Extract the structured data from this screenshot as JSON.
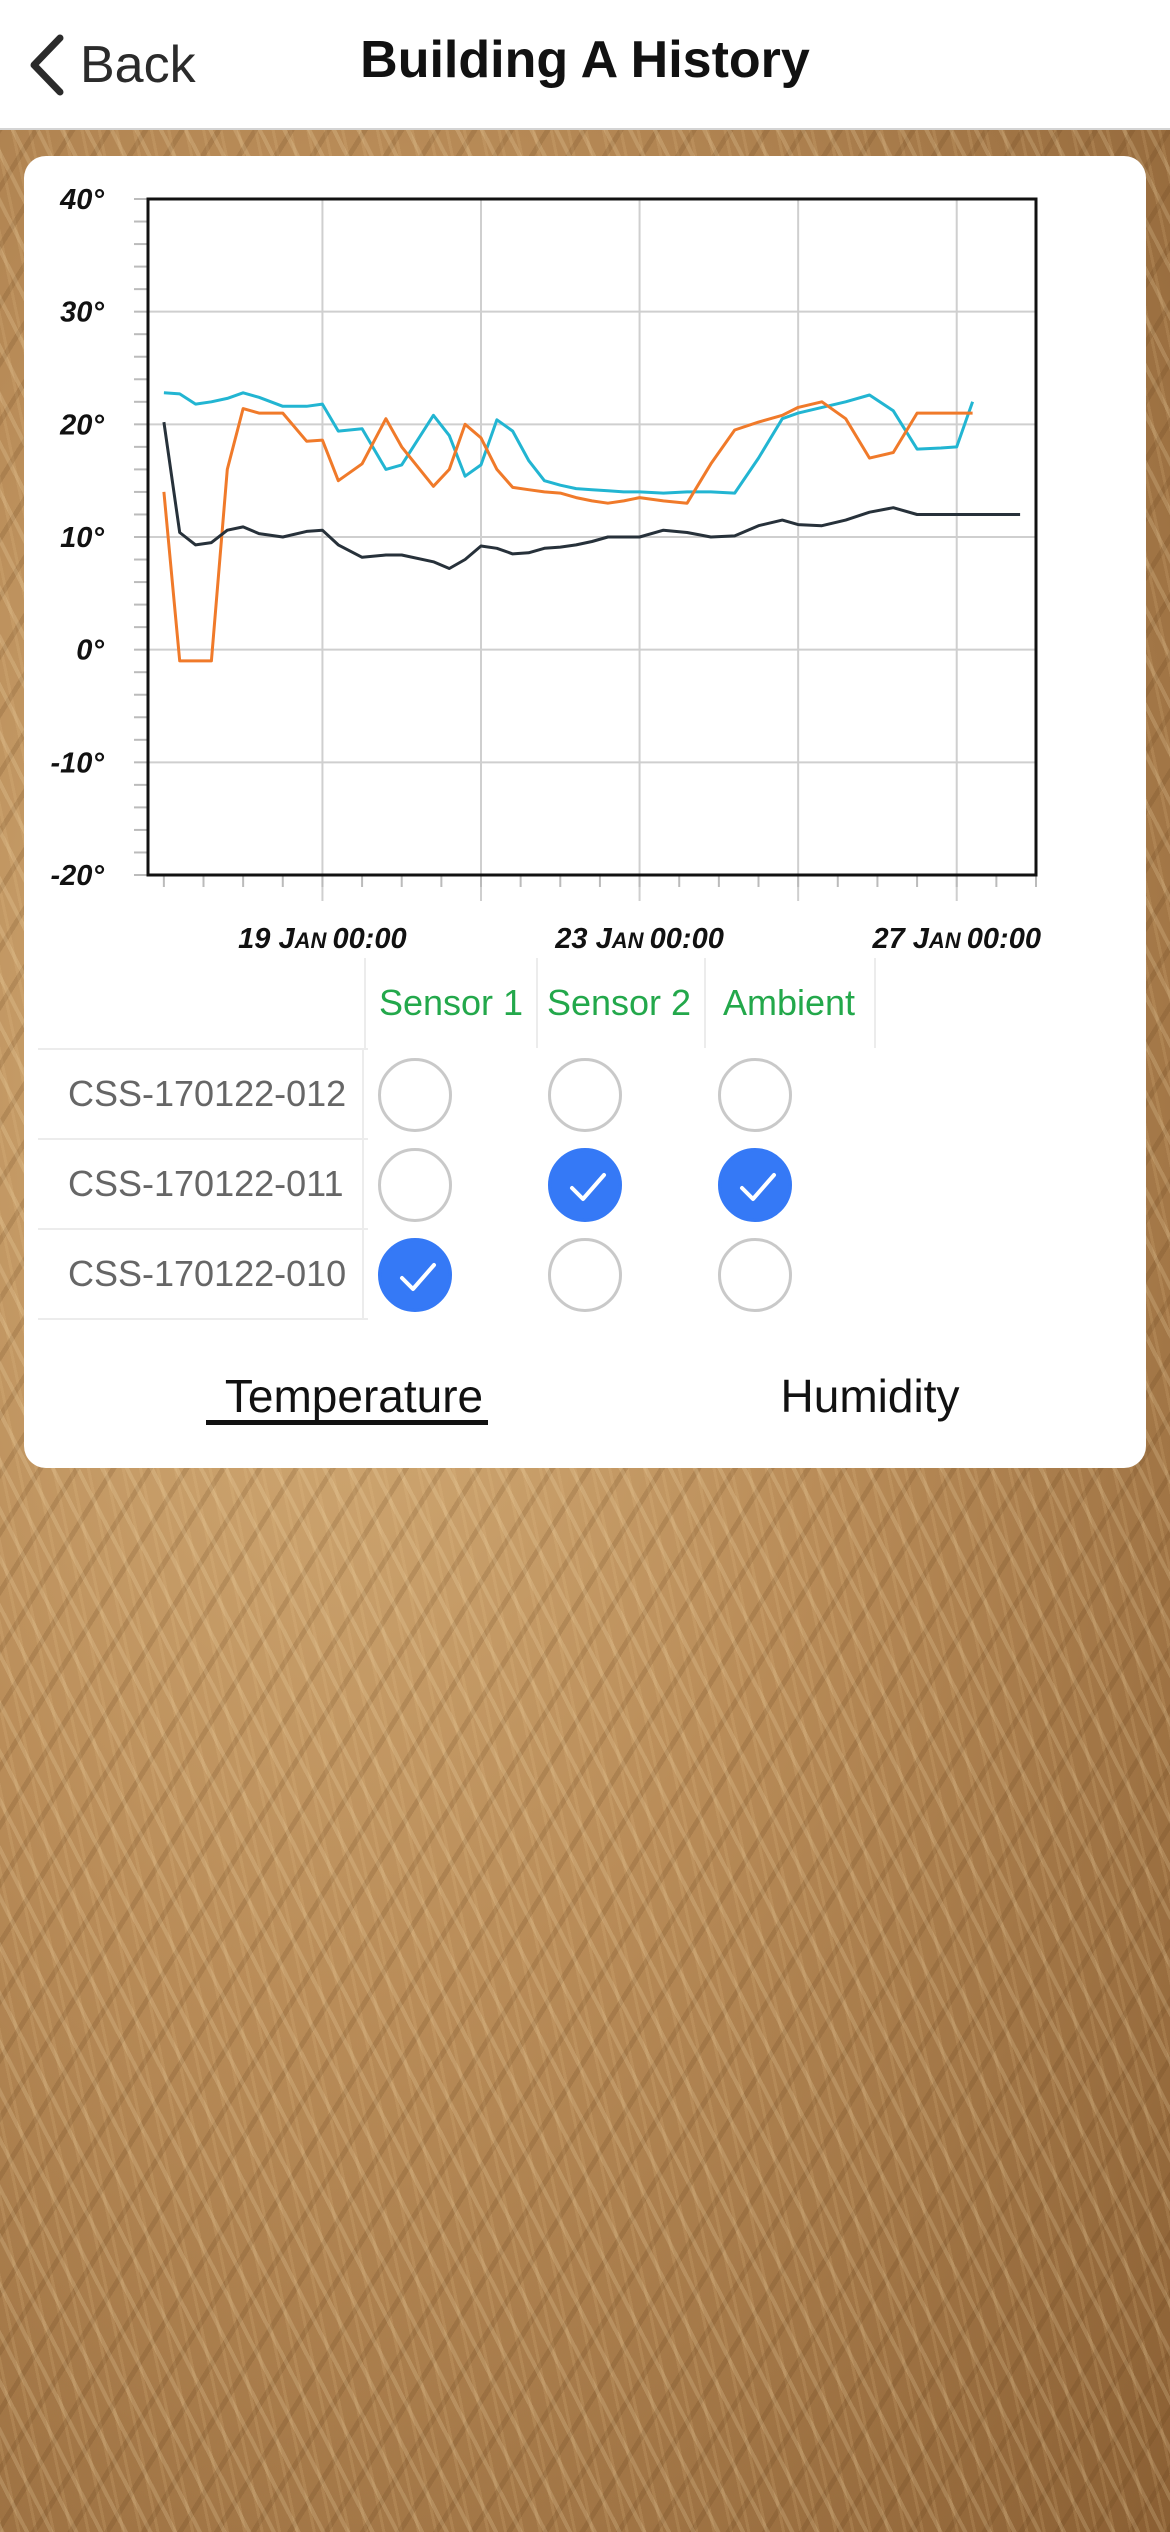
{
  "nav": {
    "back_label": "Back",
    "title": "Building A History"
  },
  "chart_data": {
    "type": "line",
    "y_ticks": [
      "40°",
      "30°",
      "20°",
      "10°",
      "0°",
      "-10°",
      "-20°"
    ],
    "ylim": [
      -20,
      40
    ],
    "x_ticks": [
      "19 Jan 00:00",
      "23 Jan 00:00",
      "27 Jan 00:00"
    ],
    "xlim_days": [
      16.8,
      28.0
    ],
    "grid": true,
    "series": [
      {
        "color": "#22b5d2",
        "x": [
          17,
          17.2,
          17.4,
          17.6,
          17.8,
          18.0,
          18.2,
          18.5,
          18.8,
          19.0,
          19.2,
          19.5,
          19.8,
          20.0,
          20.4,
          20.6,
          20.8,
          21.0,
          21.2,
          21.4,
          21.6,
          21.8,
          22.0,
          22.2,
          22.4,
          22.6,
          22.8,
          23.0,
          23.3,
          23.6,
          23.9,
          24.2,
          24.5,
          24.8,
          25.0,
          25.3,
          25.6,
          25.9,
          26.2,
          26.5,
          26.8,
          27.0,
          27.2
        ],
        "y": [
          22.8,
          22.7,
          21.8,
          22.0,
          22.3,
          22.8,
          22.4,
          21.6,
          21.6,
          21.8,
          19.4,
          19.6,
          16.0,
          16.4,
          20.8,
          19.0,
          15.4,
          16.4,
          20.4,
          19.4,
          16.8,
          15.0,
          14.6,
          14.3,
          14.2,
          14.1,
          14.0,
          14.0,
          13.9,
          14.0,
          14.0,
          13.9,
          17.0,
          20.5,
          21.0,
          21.5,
          22.0,
          22.6,
          21.2,
          17.8,
          17.9,
          18.0,
          22.0
        ]
      },
      {
        "color": "#f07a2a",
        "x": [
          17,
          17.2,
          17.4,
          17.6,
          17.8,
          18.0,
          18.2,
          18.5,
          18.8,
          19.0,
          19.2,
          19.5,
          19.8,
          20.0,
          20.4,
          20.6,
          20.8,
          21.0,
          21.2,
          21.4,
          21.6,
          21.8,
          22.0,
          22.2,
          22.4,
          22.6,
          22.8,
          23.0,
          23.3,
          23.6,
          23.9,
          24.2,
          24.5,
          24.8,
          25.0,
          25.3,
          25.6,
          25.9,
          26.2,
          26.5,
          26.8,
          27.0,
          27.2
        ],
        "y": [
          14.0,
          -1.0,
          -1.0,
          -1.0,
          16.0,
          21.4,
          21.0,
          21.0,
          18.5,
          18.6,
          15.0,
          16.5,
          20.5,
          18.0,
          14.5,
          16.0,
          20.0,
          18.8,
          16.0,
          14.4,
          14.2,
          14.0,
          13.9,
          13.5,
          13.2,
          13.0,
          13.2,
          13.5,
          13.2,
          13.0,
          16.5,
          19.5,
          20.2,
          20.8,
          21.5,
          22.0,
          20.5,
          17.0,
          17.5,
          21.0,
          21.0,
          21.0,
          21.0
        ]
      },
      {
        "color": "#27313a",
        "x": [
          17,
          17.2,
          17.4,
          17.6,
          17.8,
          18.0,
          18.2,
          18.5,
          18.8,
          19.0,
          19.2,
          19.5,
          19.8,
          20.0,
          20.4,
          20.6,
          20.8,
          21.0,
          21.2,
          21.4,
          21.6,
          21.8,
          22.0,
          22.2,
          22.4,
          22.6,
          22.8,
          23.0,
          23.3,
          23.6,
          23.9,
          24.2,
          24.5,
          24.8,
          25.0,
          25.3,
          25.6,
          25.9,
          26.2,
          26.5,
          26.8,
          27.0,
          27.2,
          27.5,
          27.8
        ],
        "y": [
          20.2,
          10.4,
          9.3,
          9.5,
          10.6,
          10.9,
          10.3,
          10.0,
          10.5,
          10.6,
          9.3,
          8.2,
          8.4,
          8.4,
          7.8,
          7.2,
          8.0,
          9.2,
          9.0,
          8.5,
          8.6,
          9.0,
          9.1,
          9.3,
          9.6,
          10.0,
          10.0,
          10.0,
          10.6,
          10.4,
          10.0,
          10.1,
          11.0,
          11.5,
          11.1,
          11.0,
          11.5,
          12.2,
          12.6,
          12.0,
          12.0,
          12.0,
          12.0,
          12.0,
          12.0
        ]
      }
    ]
  },
  "table": {
    "columns": [
      "Sensor 1",
      "Sensor 2",
      "Ambient"
    ],
    "rows": [
      {
        "label": "CSS-170122-012",
        "checks": [
          false,
          false,
          false
        ]
      },
      {
        "label": "CSS-170122-011",
        "checks": [
          false,
          true,
          true
        ]
      },
      {
        "label": "CSS-170122-010",
        "checks": [
          true,
          false,
          false
        ]
      }
    ]
  },
  "tabs": {
    "temperature": "Temperature",
    "humidity": "Humidity",
    "active": "Temperature"
  },
  "colors": {
    "accent_green": "#23a84b",
    "check_blue": "#3579f6"
  }
}
